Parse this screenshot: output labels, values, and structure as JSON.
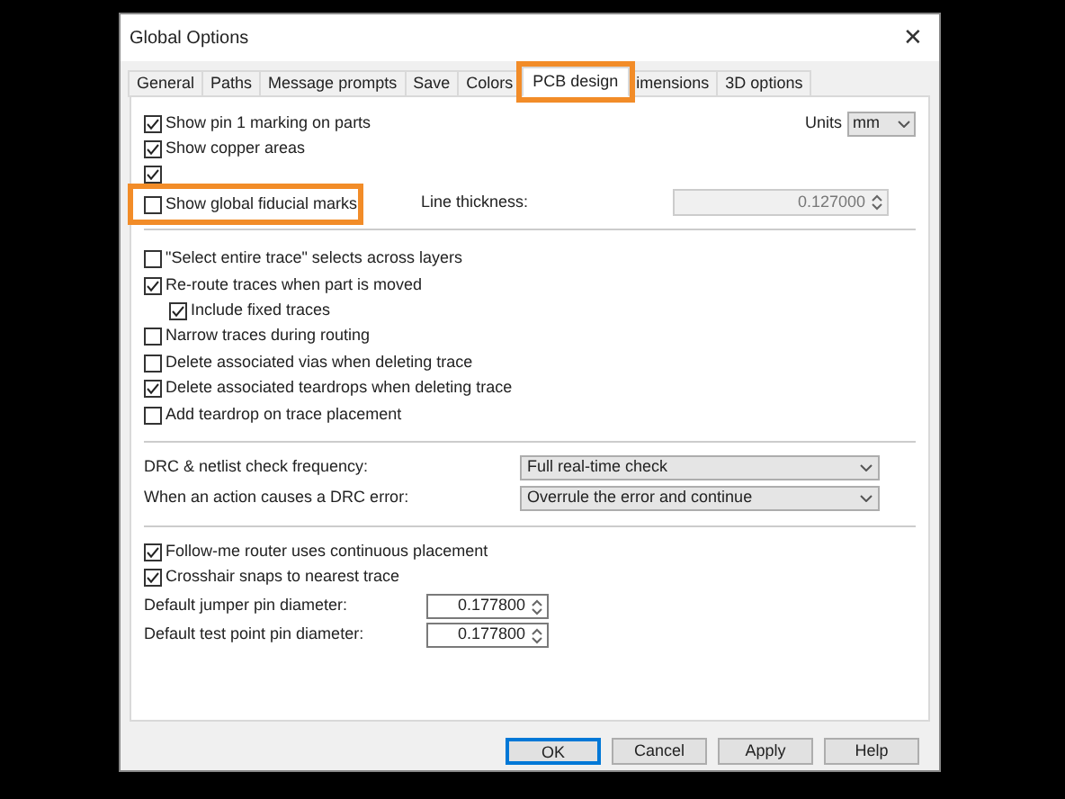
{
  "window": {
    "title": "Global Options",
    "close": "✕"
  },
  "tabs": [
    {
      "label": "General",
      "selected": false,
      "highlighted": false
    },
    {
      "label": "Paths",
      "selected": false,
      "highlighted": false
    },
    {
      "label": "Message prompts",
      "selected": false,
      "highlighted": false
    },
    {
      "label": "Save",
      "selected": false,
      "highlighted": false
    },
    {
      "label": "Colors",
      "selected": false,
      "highlighted": false
    },
    {
      "label": "PCB design",
      "selected": true,
      "highlighted": true
    },
    {
      "label": "imensions",
      "selected": false,
      "highlighted": false
    },
    {
      "label": "3D options",
      "selected": false,
      "highlighted": false
    }
  ],
  "units": {
    "label": "Units",
    "value": "mm"
  },
  "top_checks": [
    {
      "label": "Show pin 1 marking on parts",
      "checked": true
    },
    {
      "label": "Show copper areas",
      "checked": true
    },
    {
      "checked": true
    },
    {
      "label": "Show global fiducial marks",
      "checked": false,
      "highlighted": true
    }
  ],
  "line_thickness": {
    "label": "Line thickness:",
    "value": "0.127000",
    "disabled": true
  },
  "trace_checks": [
    {
      "label": "\"Select entire trace\" selects across layers",
      "checked": false
    },
    {
      "label": "Re-route traces when part is moved",
      "checked": true,
      "children": [
        {
          "label": "Include fixed traces",
          "checked": true
        }
      ]
    },
    {
      "label": "Narrow traces during routing",
      "checked": false
    },
    {
      "label": "Delete associated vias when deleting trace",
      "checked": false
    },
    {
      "label": "Delete associated teardrops when deleting trace",
      "checked": true
    },
    {
      "label": "Add teardrop on trace placement",
      "checked": false
    }
  ],
  "drc": [
    {
      "label": "DRC & netlist check frequency:",
      "value": "Full real-time check"
    },
    {
      "label": "When an action causes a DRC error:",
      "value": "Overrule the error and continue"
    }
  ],
  "router_checks": [
    {
      "label": "Follow-me router uses continuous placement",
      "checked": true
    },
    {
      "label": "Crosshair snaps to nearest trace",
      "checked": true
    }
  ],
  "diameters": [
    {
      "label": "Default jumper pin diameter:",
      "value": "0.177800"
    },
    {
      "label": "Default test point pin diameter:",
      "value": "0.177800"
    }
  ],
  "buttons": [
    {
      "label": "OK",
      "default": true
    },
    {
      "label": "Cancel",
      "default": false
    },
    {
      "label": "Apply",
      "default": false
    },
    {
      "label": "Help",
      "default": false
    }
  ]
}
